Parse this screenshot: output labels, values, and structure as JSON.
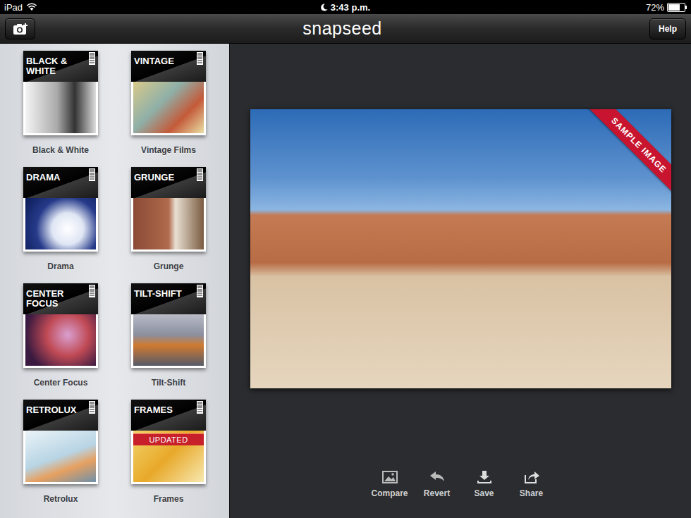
{
  "status_bar": {
    "carrier": "iPad",
    "time": "3:43 p.m.",
    "battery": "72%",
    "battery_level": 0.72
  },
  "nav_bar": {
    "title": "snapseed",
    "help_button": "Help"
  },
  "filters": [
    {
      "title": "BLACK & WHITE",
      "label": "Black & White"
    },
    {
      "title": "VINTAGE",
      "label": "Vintage Films"
    },
    {
      "title": "DRAMA",
      "label": "Drama"
    },
    {
      "title": "GRUNGE",
      "label": "Grunge"
    },
    {
      "title": "CENTER FOCUS",
      "label": "Center Focus"
    },
    {
      "title": "TILT-SHIFT",
      "label": "Tilt-Shift"
    },
    {
      "title": "RETROLUX",
      "label": "Retrolux"
    },
    {
      "title": "FRAMES",
      "label": "Frames",
      "badge": "UPDATED"
    }
  ],
  "photo": {
    "overlay": "SAMPLE IMAGE"
  },
  "toolbar": [
    {
      "label": "Compare"
    },
    {
      "label": "Revert"
    },
    {
      "label": "Save"
    },
    {
      "label": "Share"
    }
  ]
}
